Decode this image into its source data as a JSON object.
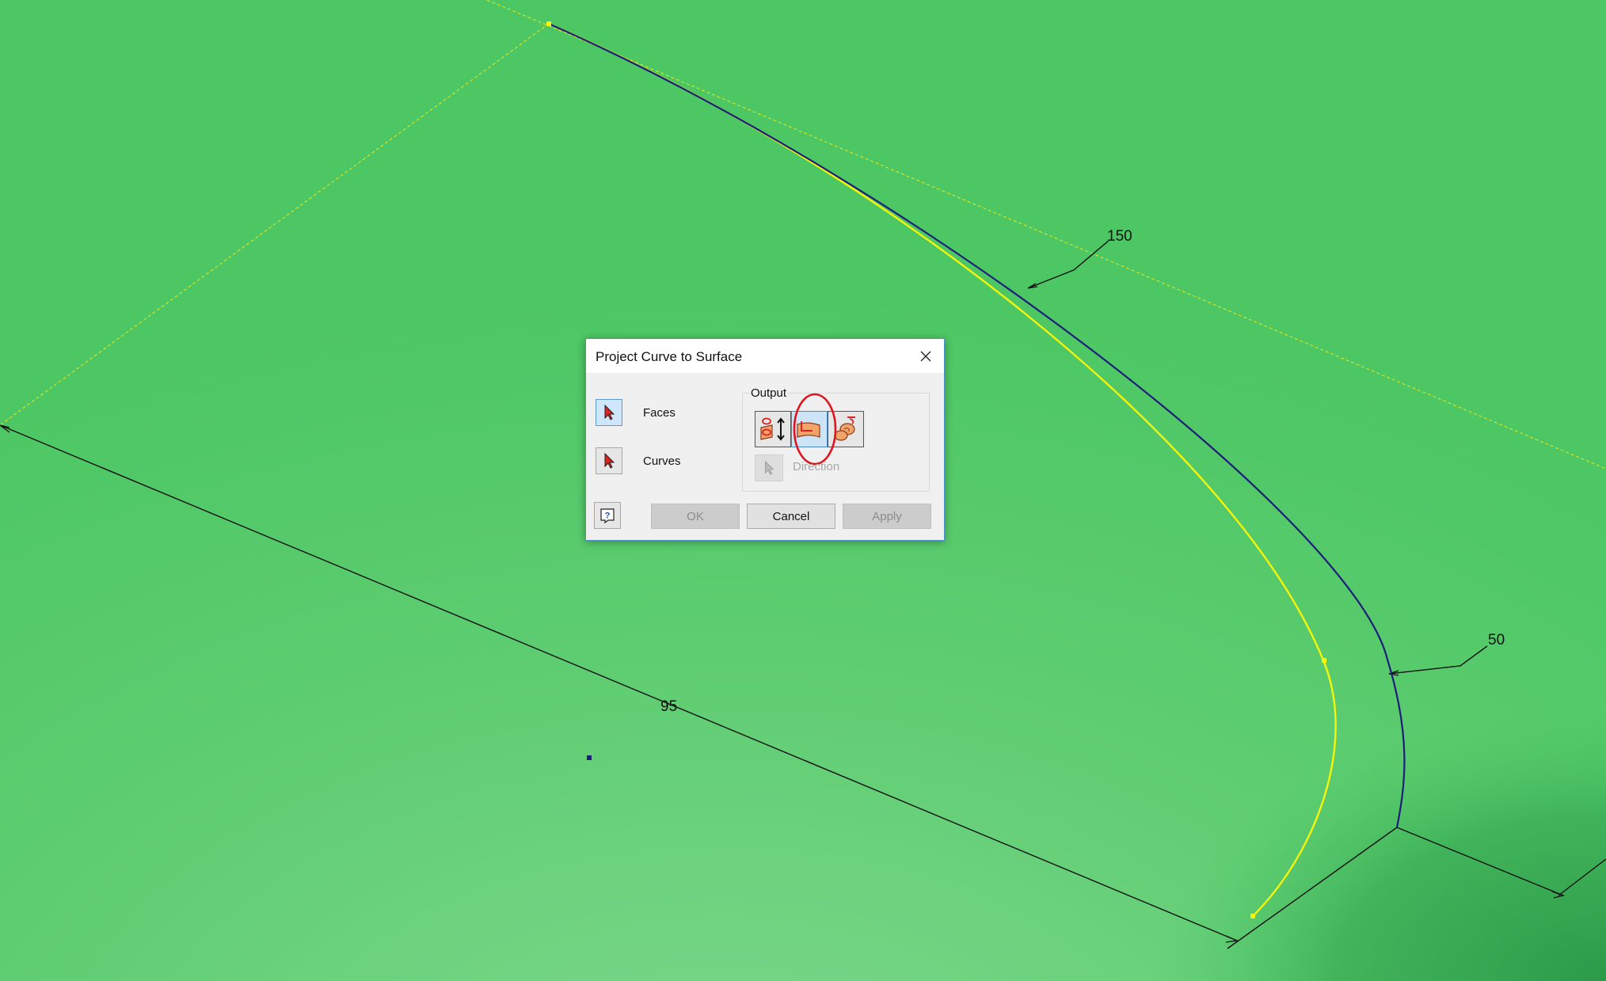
{
  "viewport": {
    "background_colors": {
      "surface_light": "#78d488",
      "surface_mid": "#4fc866",
      "surface_dark": "#2f9e4c"
    },
    "curve_colors": {
      "projected_curve": "#1e1e7a",
      "source_curve": "#f5f50a",
      "construction_line": "#e9e91c",
      "dimension_line": "#111111"
    },
    "dimensions": {
      "top": "150",
      "bottom_left": "95",
      "right": "50"
    }
  },
  "dialog": {
    "title": "Project Curve to Surface",
    "faces_label": "Faces",
    "curves_label": "Curves",
    "output_label": "Output",
    "direction_label": "Direction",
    "ok_label": "OK",
    "cancel_label": "Cancel",
    "apply_label": "Apply",
    "selected_output_index": 1,
    "highlight_color": "#e0141c"
  }
}
